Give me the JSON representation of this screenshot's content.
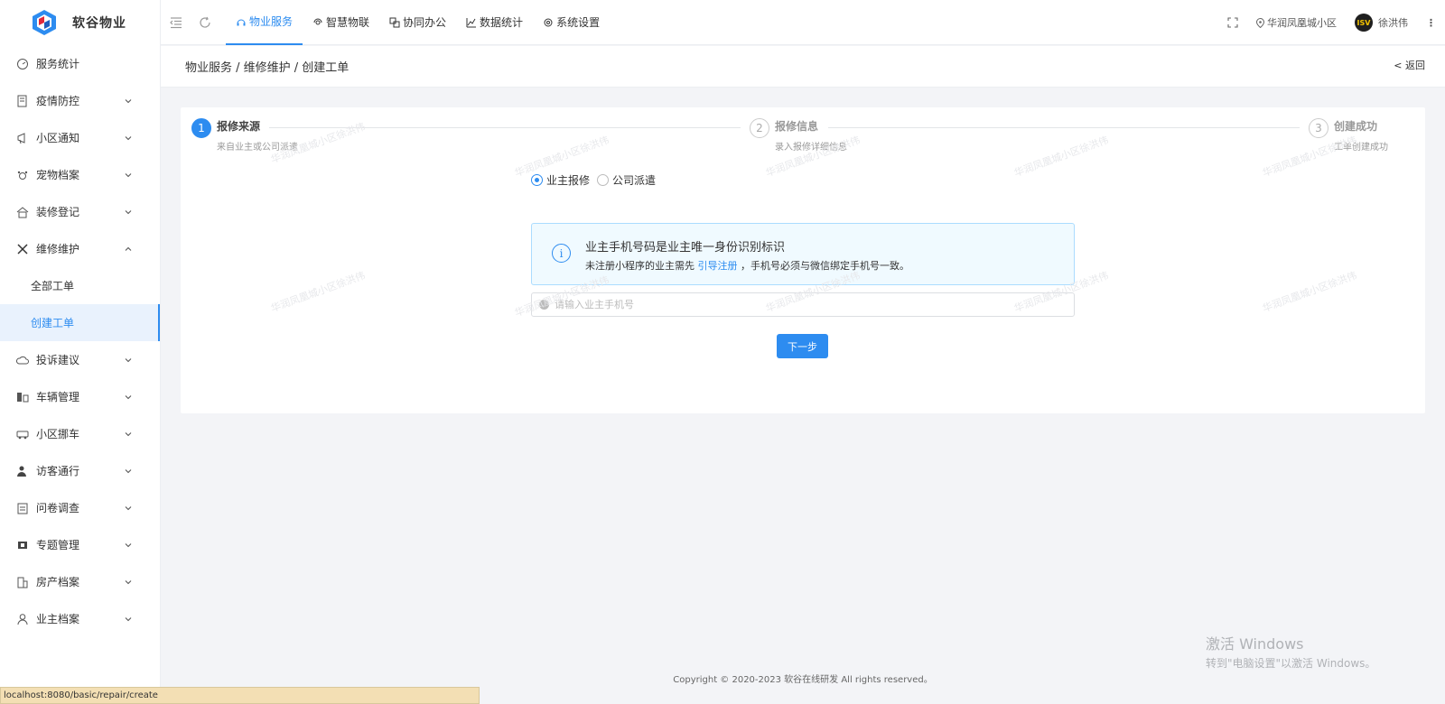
{
  "app": {
    "name": "软谷物业"
  },
  "sidebar": {
    "items": [
      {
        "label": "服务统计",
        "icon": "dashboard-icon",
        "expandable": false
      },
      {
        "label": "疫情防控",
        "icon": "document-icon",
        "expandable": true
      },
      {
        "label": "小区通知",
        "icon": "megaphone-icon",
        "expandable": true
      },
      {
        "label": "宠物档案",
        "icon": "pet-icon",
        "expandable": true
      },
      {
        "label": "装修登记",
        "icon": "house-icon",
        "expandable": true
      },
      {
        "label": "维修维护",
        "icon": "tools-icon",
        "expandable": true,
        "expanded": true
      },
      {
        "label": "投诉建议",
        "icon": "cloud-icon",
        "expandable": true
      },
      {
        "label": "车辆管理",
        "icon": "parking-icon",
        "expandable": true
      },
      {
        "label": "小区挪车",
        "icon": "car-icon",
        "expandable": true
      },
      {
        "label": "访客通行",
        "icon": "visitor-icon",
        "expandable": true
      },
      {
        "label": "问卷调查",
        "icon": "clipboard-icon",
        "expandable": true
      },
      {
        "label": "专题管理",
        "icon": "topic-icon",
        "expandable": true
      },
      {
        "label": "房产档案",
        "icon": "building-icon",
        "expandable": true
      },
      {
        "label": "业主档案",
        "icon": "user-icon",
        "expandable": true
      }
    ],
    "sub_items": [
      {
        "label": "全部工单",
        "active": false
      },
      {
        "label": "创建工单",
        "active": true
      }
    ]
  },
  "topbar": {
    "tabs": [
      {
        "label": "物业服务",
        "active": true,
        "icon": "headset-icon"
      },
      {
        "label": "智慧物联",
        "active": false,
        "icon": "iot-icon"
      },
      {
        "label": "协同办公",
        "active": false,
        "icon": "office-icon"
      },
      {
        "label": "数据统计",
        "active": false,
        "icon": "chart-icon"
      },
      {
        "label": "系统设置",
        "active": false,
        "icon": "gear-icon"
      }
    ],
    "community": "华润凤凰城小区",
    "avatar_text": "ISV",
    "user_name": "徐洪伟"
  },
  "page": {
    "breadcrumb": "物业服务 / 维修维护 / 创建工单",
    "back_label": "< 返回"
  },
  "steps": [
    {
      "num": "1",
      "title": "报修来源",
      "desc": "来自业主或公司派遣",
      "active": true
    },
    {
      "num": "2",
      "title": "报修信息",
      "desc": "录入报修详细信息",
      "active": false
    },
    {
      "num": "3",
      "title": "创建成功",
      "desc": "工单创建成功",
      "active": false
    }
  ],
  "source_options": [
    {
      "label": "业主报修",
      "checked": true
    },
    {
      "label": "公司派遣",
      "checked": false
    }
  ],
  "notice": {
    "title": "业主手机号码是业主唯一身份识别标识",
    "desc_before": "未注册小程序的业主需先",
    "link": "引导注册",
    "desc_after": "，手机号必须与微信绑定手机号一致。"
  },
  "phone_input": {
    "placeholder": "请输入业主手机号",
    "value": ""
  },
  "next_button": "下一步",
  "watermark": "华润凤凰城小区徐洪伟",
  "footer": "Copyright © 2020-2023 软谷在线研发 All rights reserved。",
  "windows": {
    "line1": "激活 Windows",
    "line2": "转到\"电脑设置\"以激活 Windows。"
  },
  "status_url": "localhost:8080/basic/repair/create",
  "colors": {
    "accent": "#2d8cf0",
    "alert_bg": "#f0faff",
    "page_bg": "#f3f4f7"
  }
}
